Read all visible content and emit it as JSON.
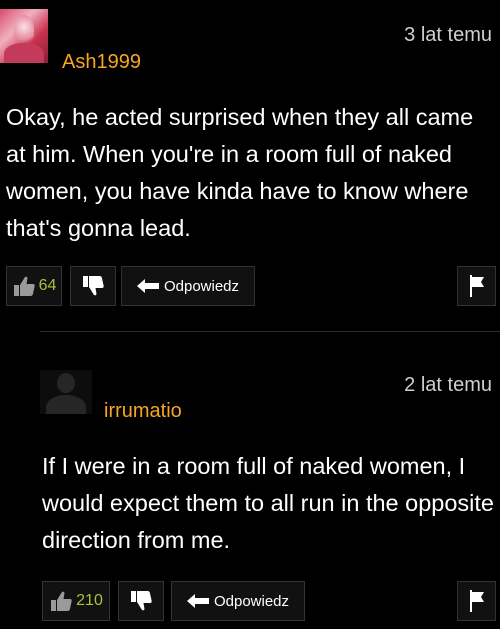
{
  "comments": [
    {
      "username": "Ash1999",
      "time": "3 lat temu",
      "text": "Okay, he acted surprised when they all came at him. When you're in a room full of naked women, you have kinda have to know where that's gonna lead.",
      "likes": "64",
      "reply_label": "Odpowiedz"
    },
    {
      "username": "irrumatio",
      "time": "2 lat temu",
      "text": "If I were in a room full of naked women, I would expect them to all run in the opposite direction from me.",
      "likes": "210",
      "reply_label": "Odpowiedz"
    }
  ],
  "colors": {
    "username": "#f5a623",
    "likes": "#a8c23a",
    "background": "#000000"
  },
  "icons": [
    "thumbs-up-icon",
    "thumbs-down-icon",
    "reply-arrow-icon",
    "flag-icon"
  ]
}
